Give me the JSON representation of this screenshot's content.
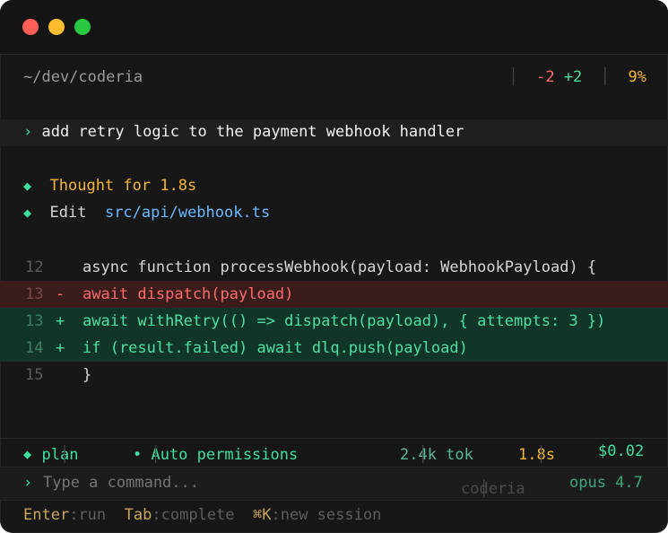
{
  "window": {
    "controls": [
      "close-dot",
      "minimize-dot",
      "zoom-dot"
    ]
  },
  "header": {
    "path": "~/dev/coderia",
    "deletions": "-2",
    "additions": "+2",
    "context_pct": "9%"
  },
  "prompt": {
    "chevron": "›",
    "text": "add retry logic to the payment webhook handler"
  },
  "events": {
    "thought": "Thought for 1.8s",
    "edit_label": "Edit",
    "edit_file": "src/api/webhook.ts"
  },
  "diff": [
    {
      "num": "12",
      "marker": " ",
      "code": "async function processWebhook(payload: WebhookPayload) {",
      "kind": "context"
    },
    {
      "num": "13",
      "marker": "-",
      "code": "await dispatch(payload)",
      "kind": "del"
    },
    {
      "num": "13",
      "marker": "+",
      "code": "await withRetry(() => dispatch(payload), { attempts: 3 })",
      "kind": "add"
    },
    {
      "num": "14",
      "marker": "+",
      "code": "if (result.failed) await dlq.push(payload)",
      "kind": "add"
    },
    {
      "num": "15",
      "marker": " ",
      "code": "}",
      "kind": "context"
    }
  ],
  "status": {
    "mode": "plan",
    "permissions": "• Auto permissions",
    "tokens": "2.4k tok",
    "time": "1.8s",
    "cost": "$0.02"
  },
  "command": {
    "chevron": "›",
    "placeholder": "Type a command...",
    "project": "coderia",
    "model": "opus 4.7"
  },
  "hints": [
    {
      "key": "Enter",
      "action": "run"
    },
    {
      "key": "Tab",
      "action": "complete"
    },
    {
      "key": "⌘K",
      "action": "new session"
    }
  ],
  "colors": {
    "accent_green": "#3ee0a0",
    "accent_amber": "#f5b73b",
    "accent_red": "#ff6b6b",
    "link_blue": "#6ab8ff",
    "background": "#171717"
  }
}
